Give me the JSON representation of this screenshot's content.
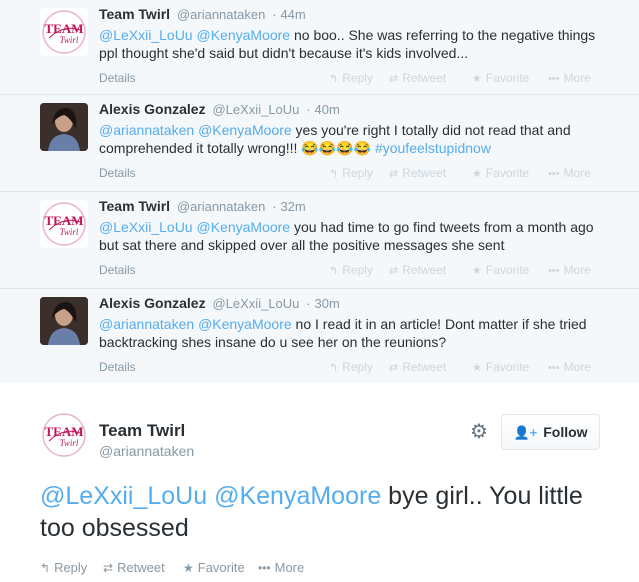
{
  "replies": [
    {
      "name": "Team Twirl",
      "handle": "@ariannataken",
      "time": "44m",
      "avatar": "team-twirl-logo",
      "text": [
        {
          "t": "@LeXxii_LoUu",
          "k": "mention"
        },
        {
          "t": " ",
          "k": "plain"
        },
        {
          "t": "@KenyaMoore",
          "k": "mention"
        },
        {
          "t": " no boo.. She was referring to the negative things ppl thought she'd said but didn't  because it's kids involved...",
          "k": "plain"
        }
      ]
    },
    {
      "name": "Alexis Gonzalez",
      "handle": "@LeXxii_LoUu",
      "time": "40m",
      "avatar": "profile-photo",
      "text": [
        {
          "t": "@ariannataken",
          "k": "mention"
        },
        {
          "t": " ",
          "k": "plain"
        },
        {
          "t": "@KenyaMoore",
          "k": "mention"
        },
        {
          "t": " yes you're right I totally did not read that and comprehended it totally wrong!!! 😂😂😂😂 ",
          "k": "plain"
        },
        {
          "t": "#youfeelstupidnow",
          "k": "hashtag"
        }
      ]
    },
    {
      "name": "Team Twirl",
      "handle": "@ariannataken",
      "time": "32m",
      "avatar": "team-twirl-logo",
      "text": [
        {
          "t": "@LeXxii_LoUu",
          "k": "mention"
        },
        {
          "t": " ",
          "k": "plain"
        },
        {
          "t": "@KenyaMoore",
          "k": "mention"
        },
        {
          "t": " you had time to go find tweets from a month ago but sat there and skipped over all the positive messages she sent",
          "k": "plain"
        }
      ]
    },
    {
      "name": "Alexis Gonzalez",
      "handle": "@LeXxii_LoUu",
      "time": "30m",
      "avatar": "profile-photo",
      "text": [
        {
          "t": "@ariannataken",
          "k": "mention"
        },
        {
          "t": " ",
          "k": "plain"
        },
        {
          "t": "@KenyaMoore",
          "k": "mention"
        },
        {
          "t": " no I read it in an article! Dont matter if she tried backtracking shes insane do u see her on the reunions?",
          "k": "plain"
        }
      ]
    }
  ],
  "reply_actions": {
    "details": "Details",
    "reply": "Reply",
    "retweet": "Retweet",
    "favorite": "Favorite",
    "more": "More"
  },
  "main_tweet": {
    "name": "Team Twirl",
    "handle": "@ariannataken",
    "follow_label": "Follow",
    "text": [
      {
        "t": "@LeXxii_LoUu",
        "k": "mention"
      },
      {
        "t": " ",
        "k": "plain"
      },
      {
        "t": "@KenyaMoore",
        "k": "mention"
      },
      {
        "t": " bye girl.. You little too obsessed",
        "k": "plain"
      }
    ],
    "actions": {
      "reply": "Reply",
      "retweet": "Retweet",
      "favorite": "Favorite",
      "more": "More"
    }
  },
  "logo_text": {
    "line1": "TEAM",
    "line2": "Twirl"
  },
  "colors": {
    "link": "#55acee",
    "logo_pink": "#c2185b",
    "muted": "#8899a6",
    "faded": "#ccd6dd",
    "reply_bg": "#f5f8fa"
  },
  "icons": {
    "reply": "reply-arrow-icon",
    "retweet": "retweet-icon",
    "favorite": "star-icon",
    "more": "more-dots-icon",
    "settings": "gear-icon",
    "follow": "add-user-icon"
  }
}
